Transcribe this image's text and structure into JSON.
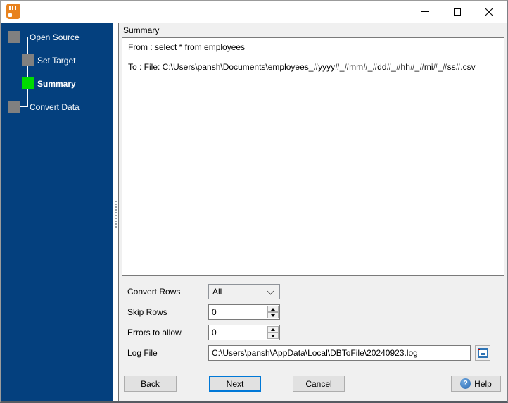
{
  "window": {
    "title": "",
    "app": "DBToFile convert wizard"
  },
  "sidebar": {
    "steps": [
      {
        "label": "Open Source",
        "state": "done"
      },
      {
        "label": "Set Target",
        "state": "done"
      },
      {
        "label": "Summary",
        "state": "active"
      },
      {
        "label": "Convert Data",
        "state": "pending"
      }
    ],
    "colors": {
      "bg": "#04407E",
      "active_step": "#00DC00",
      "inactive_step": "#808080"
    }
  },
  "main": {
    "panel_title": "Summary",
    "summary": {
      "from_line": "From : select * from employees",
      "to_line": "To : File: C:\\Users\\pansh\\Documents\\employees_#yyyy#_#mm#_#dd#_#hh#_#mi#_#ss#.csv"
    },
    "fields": {
      "convert_rows": {
        "label": "Convert Rows",
        "value": "All"
      },
      "skip_rows": {
        "label": "Skip Rows",
        "value": "0"
      },
      "errors_to_allow": {
        "label": "Errors to allow",
        "value": "0"
      },
      "log_file": {
        "label": "Log File",
        "value": "C:\\Users\\pansh\\AppData\\Local\\DBToFile\\20240923.log"
      }
    },
    "buttons": {
      "back": "Back",
      "next": "Next",
      "cancel": "Cancel",
      "help": "Help"
    },
    "help_icon_char": "?",
    "colors": {
      "next_focus_border": "#0078D7"
    }
  }
}
